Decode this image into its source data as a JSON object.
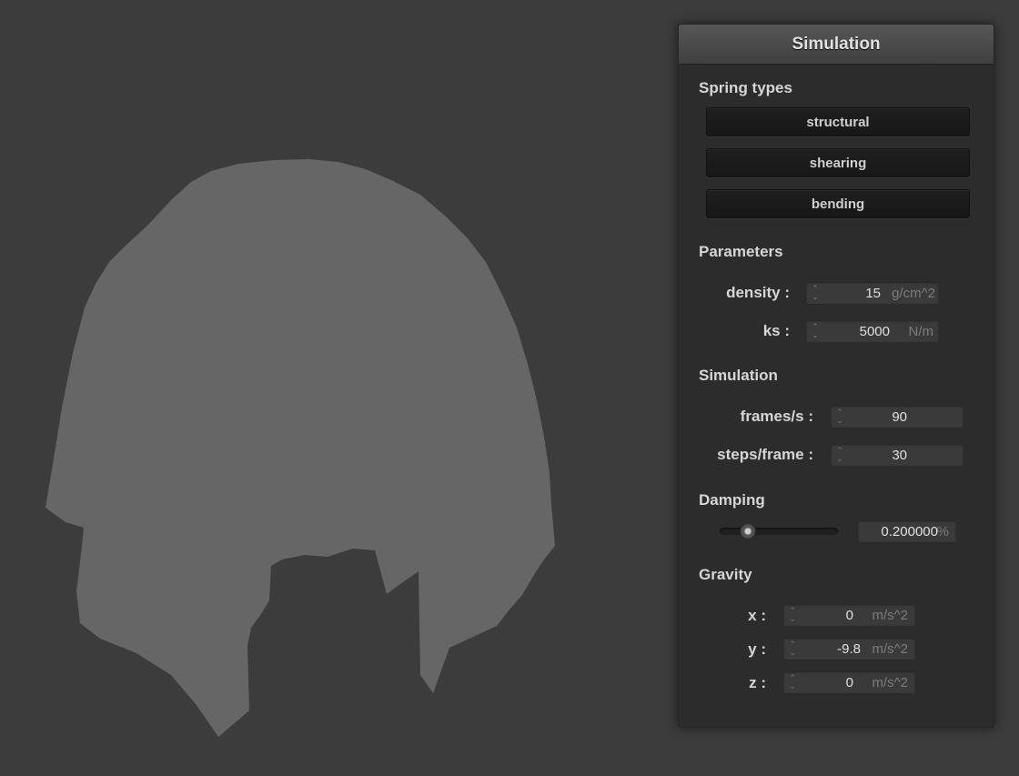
{
  "panel": {
    "title": "Simulation",
    "spring_types": {
      "label": "Spring types",
      "buttons": [
        "structural",
        "shearing",
        "bending"
      ]
    },
    "parameters": {
      "label": "Parameters",
      "density": {
        "label": "density :",
        "value": "15",
        "unit": "g/cm^2"
      },
      "ks": {
        "label": "ks :",
        "value": "5000",
        "unit": "N/m"
      }
    },
    "simulation": {
      "label": "Simulation",
      "frames": {
        "label": "frames/s :",
        "value": "90"
      },
      "steps": {
        "label": "steps/frame :",
        "value": "30"
      }
    },
    "damping": {
      "label": "Damping",
      "value": "0.200000",
      "unit": "%",
      "slider_level": 0.2
    },
    "gravity": {
      "label": "Gravity",
      "x": {
        "label": "x :",
        "value": "0",
        "unit": "m/s^2"
      },
      "y": {
        "label": "y :",
        "value": "-9.8",
        "unit": "m/s^2"
      },
      "z": {
        "label": "z :",
        "value": "0",
        "unit": "m/s^2"
      }
    }
  },
  "colors": {
    "background": "#3c3c3c",
    "cloth": "#666666",
    "panel": "#2c2c2c"
  },
  "icons": {
    "spinner": "up-down-chevron"
  }
}
